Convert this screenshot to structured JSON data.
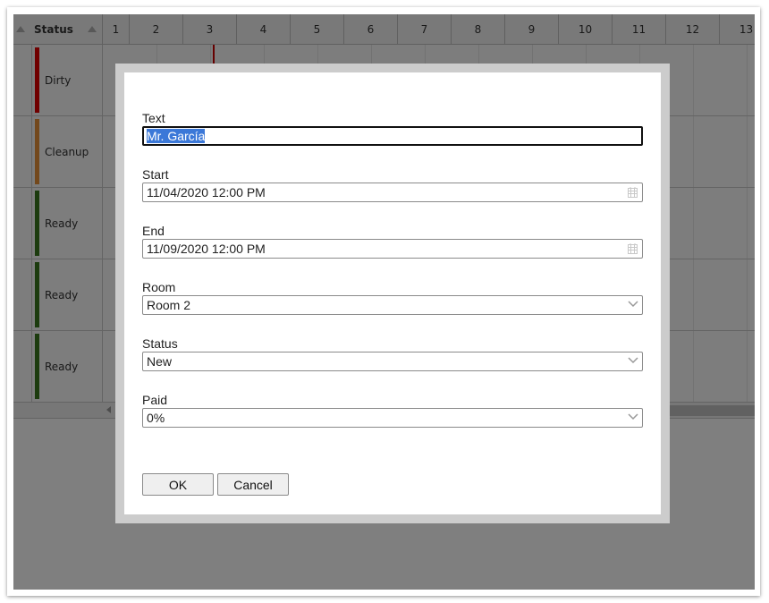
{
  "scheduler": {
    "status_header": "Status",
    "day_columns": [
      "1",
      "2",
      "3",
      "4",
      "5",
      "6",
      "7",
      "8",
      "9",
      "10",
      "11",
      "12",
      "13"
    ],
    "rows": [
      {
        "status": "Dirty",
        "color": "#e00000"
      },
      {
        "status": "Cleanup",
        "color": "#e69138"
      },
      {
        "status": "Ready",
        "color": "#38761d"
      },
      {
        "status": "Ready",
        "color": "#38761d"
      },
      {
        "status": "Ready",
        "color": "#38761d"
      }
    ],
    "current_time_color": "#cc0000"
  },
  "dialog": {
    "text": {
      "label": "Text",
      "value": "Mr. García"
    },
    "start": {
      "label": "Start",
      "value": "11/04/2020 12:00 PM",
      "icon": "calendar-icon"
    },
    "end": {
      "label": "End",
      "value": "11/09/2020 12:00 PM",
      "icon": "calendar-icon"
    },
    "room": {
      "label": "Room",
      "value": "Room 2",
      "icon": "chevron-down-icon"
    },
    "status": {
      "label": "Status",
      "value": "New",
      "icon": "chevron-down-icon"
    },
    "paid": {
      "label": "Paid",
      "value": "0%",
      "icon": "chevron-down-icon"
    },
    "ok_label": "OK",
    "cancel_label": "Cancel"
  }
}
